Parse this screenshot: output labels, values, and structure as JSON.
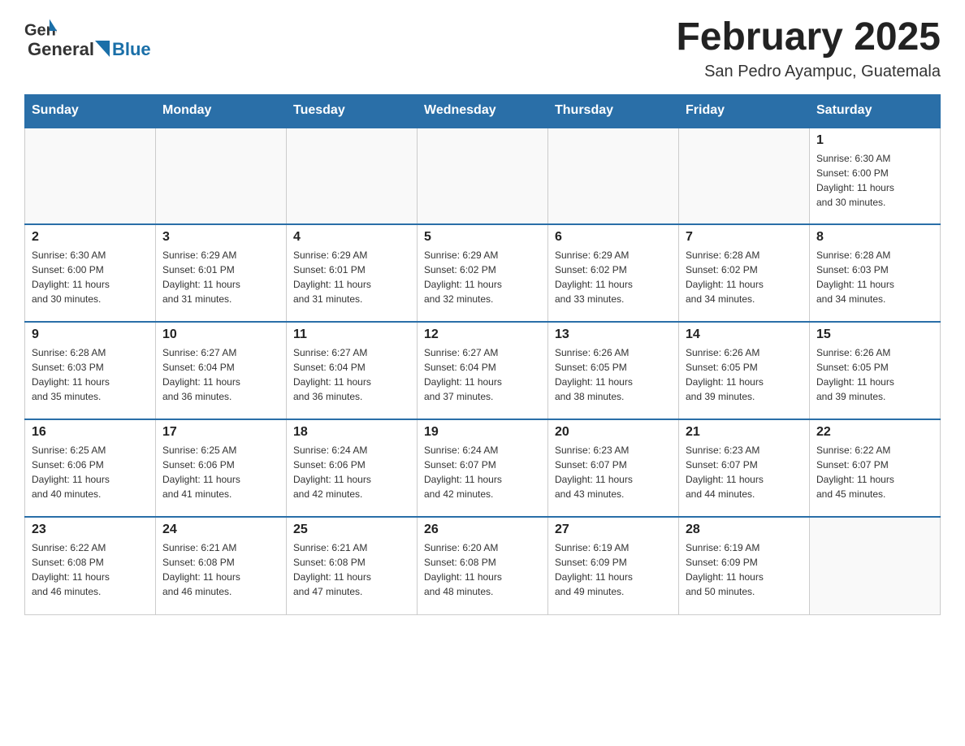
{
  "header": {
    "logo_general": "General",
    "logo_blue": "Blue",
    "title": "February 2025",
    "subtitle": "San Pedro Ayampuc, Guatemala"
  },
  "days_of_week": [
    "Sunday",
    "Monday",
    "Tuesday",
    "Wednesday",
    "Thursday",
    "Friday",
    "Saturday"
  ],
  "weeks": [
    [
      {
        "day": "",
        "info": []
      },
      {
        "day": "",
        "info": []
      },
      {
        "day": "",
        "info": []
      },
      {
        "day": "",
        "info": []
      },
      {
        "day": "",
        "info": []
      },
      {
        "day": "",
        "info": []
      },
      {
        "day": "1",
        "info": [
          "Sunrise: 6:30 AM",
          "Sunset: 6:00 PM",
          "Daylight: 11 hours",
          "and 30 minutes."
        ]
      }
    ],
    [
      {
        "day": "2",
        "info": [
          "Sunrise: 6:30 AM",
          "Sunset: 6:00 PM",
          "Daylight: 11 hours",
          "and 30 minutes."
        ]
      },
      {
        "day": "3",
        "info": [
          "Sunrise: 6:29 AM",
          "Sunset: 6:01 PM",
          "Daylight: 11 hours",
          "and 31 minutes."
        ]
      },
      {
        "day": "4",
        "info": [
          "Sunrise: 6:29 AM",
          "Sunset: 6:01 PM",
          "Daylight: 11 hours",
          "and 31 minutes."
        ]
      },
      {
        "day": "5",
        "info": [
          "Sunrise: 6:29 AM",
          "Sunset: 6:02 PM",
          "Daylight: 11 hours",
          "and 32 minutes."
        ]
      },
      {
        "day": "6",
        "info": [
          "Sunrise: 6:29 AM",
          "Sunset: 6:02 PM",
          "Daylight: 11 hours",
          "and 33 minutes."
        ]
      },
      {
        "day": "7",
        "info": [
          "Sunrise: 6:28 AM",
          "Sunset: 6:02 PM",
          "Daylight: 11 hours",
          "and 34 minutes."
        ]
      },
      {
        "day": "8",
        "info": [
          "Sunrise: 6:28 AM",
          "Sunset: 6:03 PM",
          "Daylight: 11 hours",
          "and 34 minutes."
        ]
      }
    ],
    [
      {
        "day": "9",
        "info": [
          "Sunrise: 6:28 AM",
          "Sunset: 6:03 PM",
          "Daylight: 11 hours",
          "and 35 minutes."
        ]
      },
      {
        "day": "10",
        "info": [
          "Sunrise: 6:27 AM",
          "Sunset: 6:04 PM",
          "Daylight: 11 hours",
          "and 36 minutes."
        ]
      },
      {
        "day": "11",
        "info": [
          "Sunrise: 6:27 AM",
          "Sunset: 6:04 PM",
          "Daylight: 11 hours",
          "and 36 minutes."
        ]
      },
      {
        "day": "12",
        "info": [
          "Sunrise: 6:27 AM",
          "Sunset: 6:04 PM",
          "Daylight: 11 hours",
          "and 37 minutes."
        ]
      },
      {
        "day": "13",
        "info": [
          "Sunrise: 6:26 AM",
          "Sunset: 6:05 PM",
          "Daylight: 11 hours",
          "and 38 minutes."
        ]
      },
      {
        "day": "14",
        "info": [
          "Sunrise: 6:26 AM",
          "Sunset: 6:05 PM",
          "Daylight: 11 hours",
          "and 39 minutes."
        ]
      },
      {
        "day": "15",
        "info": [
          "Sunrise: 6:26 AM",
          "Sunset: 6:05 PM",
          "Daylight: 11 hours",
          "and 39 minutes."
        ]
      }
    ],
    [
      {
        "day": "16",
        "info": [
          "Sunrise: 6:25 AM",
          "Sunset: 6:06 PM",
          "Daylight: 11 hours",
          "and 40 minutes."
        ]
      },
      {
        "day": "17",
        "info": [
          "Sunrise: 6:25 AM",
          "Sunset: 6:06 PM",
          "Daylight: 11 hours",
          "and 41 minutes."
        ]
      },
      {
        "day": "18",
        "info": [
          "Sunrise: 6:24 AM",
          "Sunset: 6:06 PM",
          "Daylight: 11 hours",
          "and 42 minutes."
        ]
      },
      {
        "day": "19",
        "info": [
          "Sunrise: 6:24 AM",
          "Sunset: 6:07 PM",
          "Daylight: 11 hours",
          "and 42 minutes."
        ]
      },
      {
        "day": "20",
        "info": [
          "Sunrise: 6:23 AM",
          "Sunset: 6:07 PM",
          "Daylight: 11 hours",
          "and 43 minutes."
        ]
      },
      {
        "day": "21",
        "info": [
          "Sunrise: 6:23 AM",
          "Sunset: 6:07 PM",
          "Daylight: 11 hours",
          "and 44 minutes."
        ]
      },
      {
        "day": "22",
        "info": [
          "Sunrise: 6:22 AM",
          "Sunset: 6:07 PM",
          "Daylight: 11 hours",
          "and 45 minutes."
        ]
      }
    ],
    [
      {
        "day": "23",
        "info": [
          "Sunrise: 6:22 AM",
          "Sunset: 6:08 PM",
          "Daylight: 11 hours",
          "and 46 minutes."
        ]
      },
      {
        "day": "24",
        "info": [
          "Sunrise: 6:21 AM",
          "Sunset: 6:08 PM",
          "Daylight: 11 hours",
          "and 46 minutes."
        ]
      },
      {
        "day": "25",
        "info": [
          "Sunrise: 6:21 AM",
          "Sunset: 6:08 PM",
          "Daylight: 11 hours",
          "and 47 minutes."
        ]
      },
      {
        "day": "26",
        "info": [
          "Sunrise: 6:20 AM",
          "Sunset: 6:08 PM",
          "Daylight: 11 hours",
          "and 48 minutes."
        ]
      },
      {
        "day": "27",
        "info": [
          "Sunrise: 6:19 AM",
          "Sunset: 6:09 PM",
          "Daylight: 11 hours",
          "and 49 minutes."
        ]
      },
      {
        "day": "28",
        "info": [
          "Sunrise: 6:19 AM",
          "Sunset: 6:09 PM",
          "Daylight: 11 hours",
          "and 50 minutes."
        ]
      },
      {
        "day": "",
        "info": []
      }
    ]
  ]
}
